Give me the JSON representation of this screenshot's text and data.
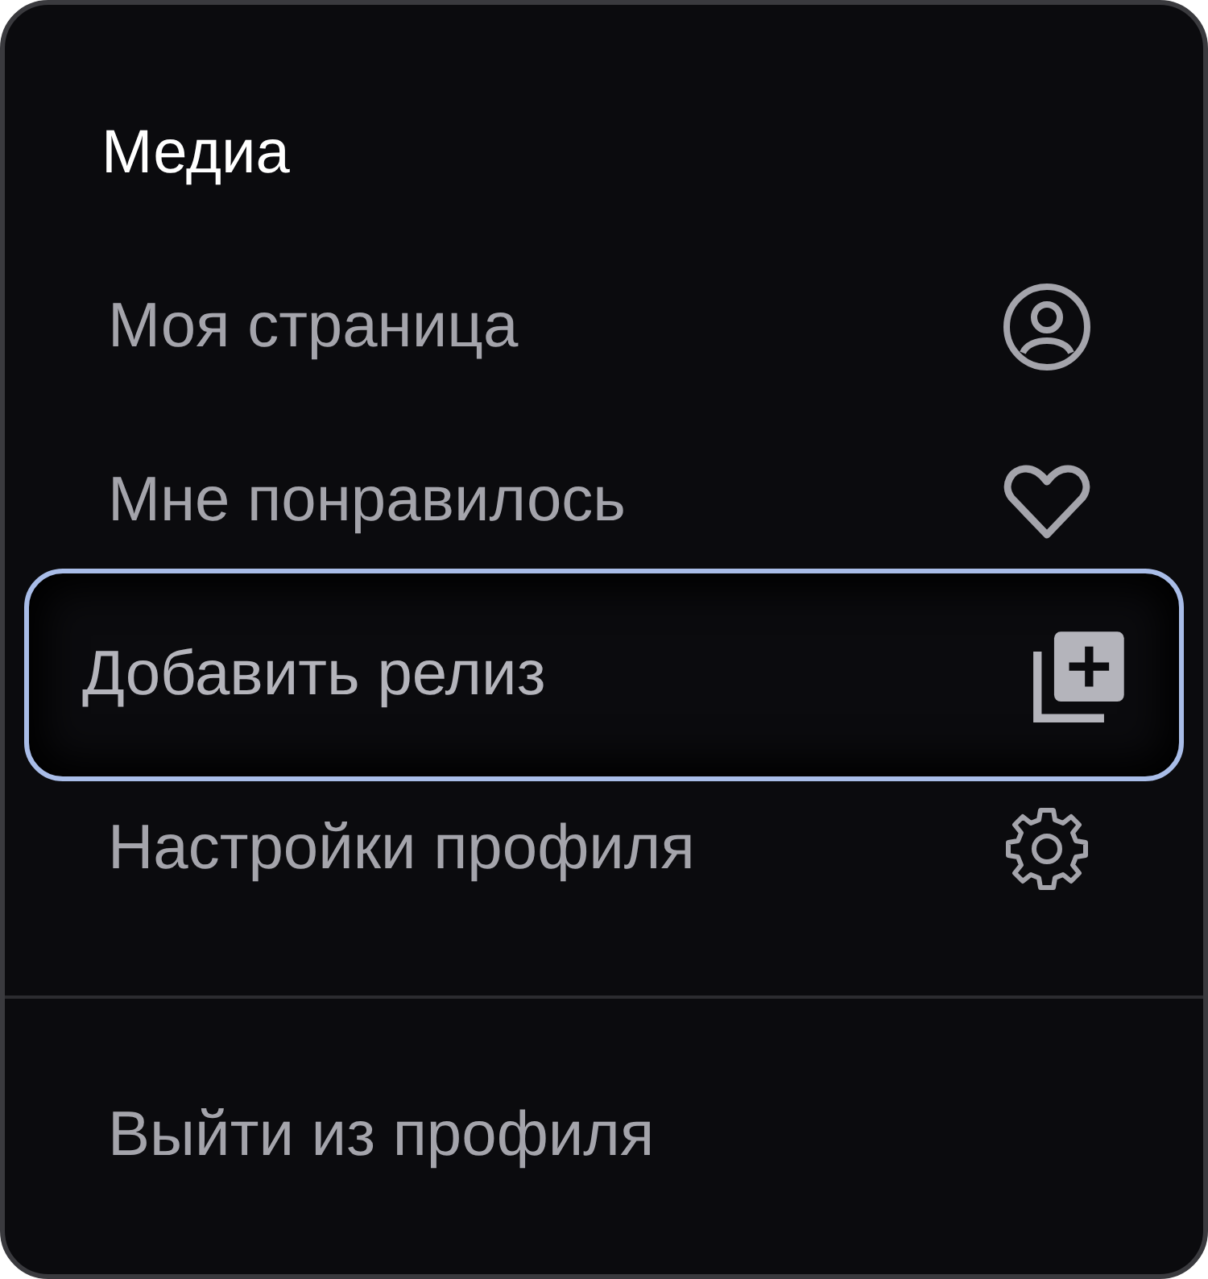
{
  "title": "Медиа",
  "items": [
    {
      "label": "Моя страница",
      "selected": false
    },
    {
      "label": "Мне понравилось",
      "selected": false
    },
    {
      "label": "Добавить релиз",
      "selected": true
    },
    {
      "label": "Настройки профиля",
      "selected": false
    }
  ],
  "logout": {
    "label": "Выйти из профиля"
  }
}
